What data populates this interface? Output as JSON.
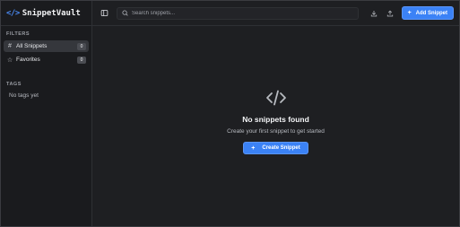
{
  "app": {
    "brand_icon": "</>",
    "name": "SnippetVault",
    "accent": "#3b82f6"
  },
  "sidebar": {
    "filters_title": "FILTERS",
    "items": [
      {
        "icon": "hash-icon",
        "glyph": "#",
        "label": "All Snippets",
        "count": "0"
      },
      {
        "icon": "star-icon",
        "glyph": "☆",
        "label": "Favorites",
        "count": "0"
      }
    ],
    "tags_title": "TAGS",
    "no_tags": "No tags yet"
  },
  "topbar": {
    "search_placeholder": "Search snippets...",
    "add_label": "Add Snippet",
    "plus": "+"
  },
  "empty_state": {
    "title": "No snippets found",
    "subtitle": "Create your first snippet to get started",
    "create_label": "Create Snippet",
    "plus": "+"
  }
}
